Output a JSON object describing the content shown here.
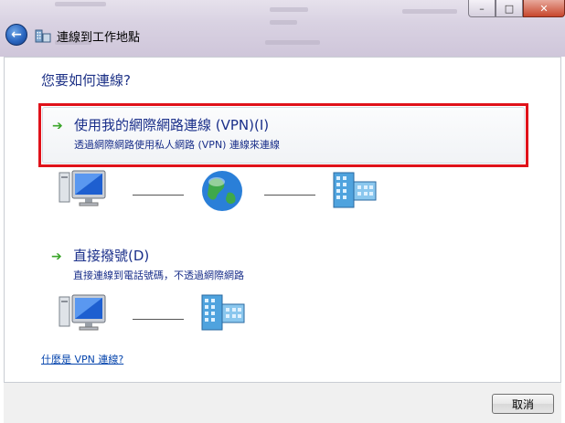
{
  "wizard": {
    "title": "連線到工作地點",
    "back_button": "back-arrow"
  },
  "main": {
    "question": "您要如何連線?",
    "options": [
      {
        "title": "使用我的網際網路連線 (VPN)(I)",
        "description": "透過網際網路使用私人網路 (VPN) 連線來連線",
        "icons": [
          "computer-icon",
          "globe-icon",
          "office-building-icon"
        ],
        "highlighted": true
      },
      {
        "title": "直接撥號(D)",
        "description": "直接連線到電話號碼，不透過網際網路",
        "icons": [
          "computer-icon",
          "office-building-icon"
        ]
      }
    ],
    "help_link": "什麼是 VPN 連線?"
  },
  "footer": {
    "cancel_label": "取消"
  },
  "colors": {
    "heading": "#1e3287",
    "option_text": "#1a2f8a",
    "highlight_border": "#e0121a",
    "arrow": "#3aa52a",
    "link": "#0645ad"
  }
}
